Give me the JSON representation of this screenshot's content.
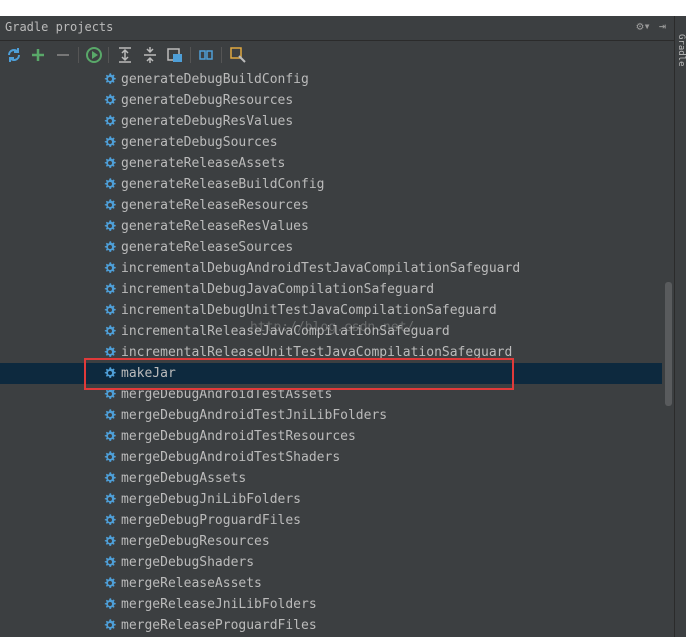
{
  "panel": {
    "title": "Gradle projects",
    "title_icons": [
      {
        "name": "gear-dropdown-icon",
        "glyph": "⚙▾"
      },
      {
        "name": "hide-panel-icon",
        "glyph": "⇥"
      }
    ]
  },
  "toolbar": {
    "buttons": [
      {
        "name": "refresh-icon",
        "color": "#4e9fd8"
      },
      {
        "name": "add-icon",
        "color": "#59a869"
      },
      {
        "name": "remove-icon",
        "color": "#777777"
      },
      {
        "name": "execute-task-icon",
        "color": "#59a869"
      },
      {
        "name": "expand-all-icon",
        "color": "#bbbbbb"
      },
      {
        "name": "collapse-all-icon",
        "color": "#bbbbbb"
      },
      {
        "name": "attach-project-icon",
        "color": "#bbbbbb"
      },
      {
        "name": "toggle-offline-icon",
        "color": "#4e9fd8"
      },
      {
        "name": "settings-icon",
        "color": "#e0a840"
      }
    ]
  },
  "tasks": [
    {
      "label": "generateDebugBuildConfig"
    },
    {
      "label": "generateDebugResources"
    },
    {
      "label": "generateDebugResValues"
    },
    {
      "label": "generateDebugSources"
    },
    {
      "label": "generateReleaseAssets"
    },
    {
      "label": "generateReleaseBuildConfig"
    },
    {
      "label": "generateReleaseResources"
    },
    {
      "label": "generateReleaseResValues"
    },
    {
      "label": "generateReleaseSources"
    },
    {
      "label": "incrementalDebugAndroidTestJavaCompilationSafeguard"
    },
    {
      "label": "incrementalDebugJavaCompilationSafeguard"
    },
    {
      "label": "incrementalDebugUnitTestJavaCompilationSafeguard"
    },
    {
      "label": "incrementalReleaseJavaCompilationSafeguard"
    },
    {
      "label": "incrementalReleaseUnitTestJavaCompilationSafeguard"
    },
    {
      "label": "makeJar",
      "selected": true
    },
    {
      "label": "mergeDebugAndroidTestAssets"
    },
    {
      "label": "mergeDebugAndroidTestJniLibFolders"
    },
    {
      "label": "mergeDebugAndroidTestResources"
    },
    {
      "label": "mergeDebugAndroidTestShaders"
    },
    {
      "label": "mergeDebugAssets"
    },
    {
      "label": "mergeDebugJniLibFolders"
    },
    {
      "label": "mergeDebugProguardFiles"
    },
    {
      "label": "mergeDebugResources"
    },
    {
      "label": "mergeDebugShaders"
    },
    {
      "label": "mergeReleaseAssets"
    },
    {
      "label": "mergeReleaseJniLibFolders"
    },
    {
      "label": "mergeReleaseProguardFiles"
    }
  ],
  "watermark": "http://blog.csdn.net/",
  "side_strip": {
    "label": "Gradle"
  },
  "colors": {
    "background": "#3c3f41",
    "selection": "#0d293e",
    "gear_icon": "#4e9fd8",
    "highlight_border": "#e03a3a",
    "text": "#bbbbbb"
  }
}
